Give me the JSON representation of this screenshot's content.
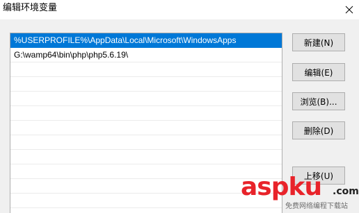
{
  "window": {
    "title": "编辑环境变量",
    "close_icon": "close-icon"
  },
  "list": {
    "items": [
      {
        "text": "%USERPROFILE%\\AppData\\Local\\Microsoft\\WindowsApps",
        "selected": true
      },
      {
        "text": "G:\\wamp64\\bin\\php\\php5.6.19\\",
        "selected": false
      }
    ],
    "selection_color": "#0078d7"
  },
  "buttons": {
    "new_label": "新建(N)",
    "edit_label": "编辑(E)",
    "browse_label": "浏览(B)...",
    "delete_label": "删除(D)",
    "move_up_label": "上移(U)"
  },
  "watermark": {
    "brand_asp": "asp",
    "brand_ku": "ku",
    "brand_suffix": ".com",
    "subtitle": "免费网络编程下载站"
  }
}
